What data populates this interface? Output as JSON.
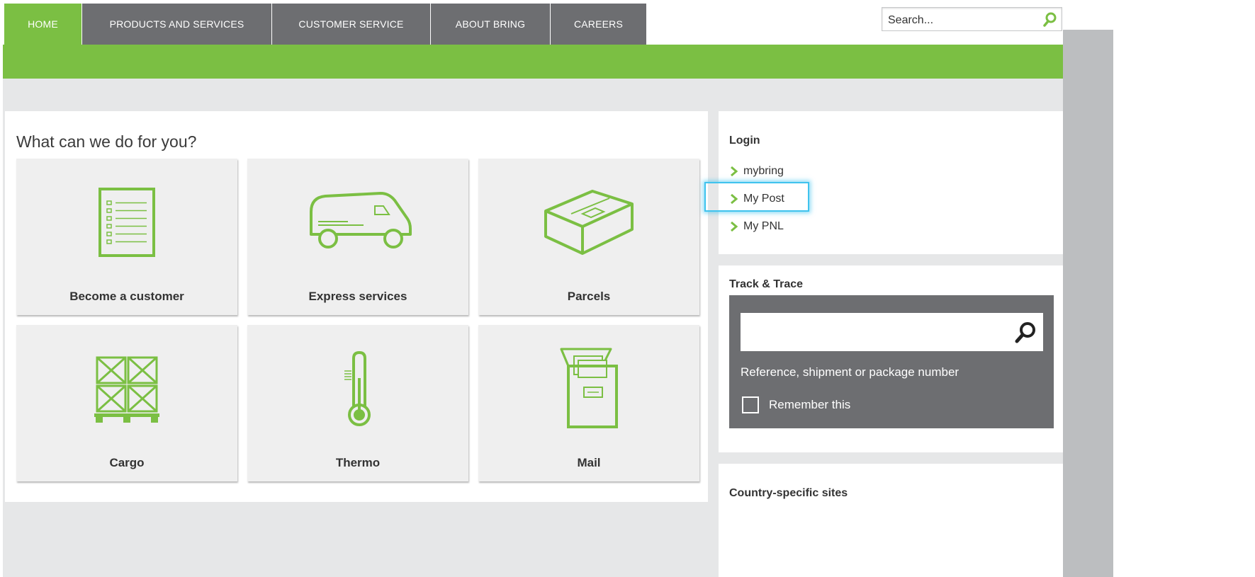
{
  "nav": {
    "tabs": [
      {
        "label": "HOME"
      },
      {
        "label": "PRODUCTS AND SERVICES"
      },
      {
        "label": "CUSTOMER SERVICE"
      },
      {
        "label": "ABOUT BRING"
      },
      {
        "label": "CAREERS"
      }
    ],
    "active_tab": "HOME",
    "search_placeholder": "Search..."
  },
  "main": {
    "title": "What can we do for you?",
    "cards": [
      {
        "label": "Become a customer",
        "icon": "form-list-icon"
      },
      {
        "label": "Express services",
        "icon": "van-icon"
      },
      {
        "label": "Parcels",
        "icon": "parcel-box-icon"
      },
      {
        "label": "Cargo",
        "icon": "pallet-crates-icon"
      },
      {
        "label": "Thermo",
        "icon": "thermometer-icon"
      },
      {
        "label": "Mail",
        "icon": "mailbox-icon"
      }
    ]
  },
  "login": {
    "heading": "Login",
    "links": [
      {
        "label": "mybring"
      },
      {
        "label": "My Post"
      },
      {
        "label": "My PNL"
      }
    ]
  },
  "track": {
    "heading": "Track & Trace",
    "input_value": "",
    "help_text": "Reference, shipment or package number",
    "remember_label": "Remember this",
    "remember_checked": false
  },
  "country": {
    "heading": "Country-specific sites"
  },
  "colors": {
    "brand_green": "#7bbf43",
    "nav_gray": "#6d6e71",
    "page_gray": "#e6e7e8",
    "highlight_blue": "#3fc3ee"
  }
}
